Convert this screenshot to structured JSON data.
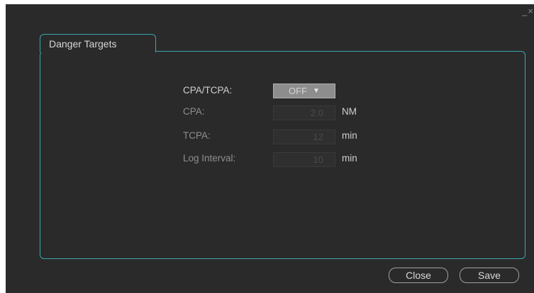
{
  "window": {
    "minimize_glyph": "_",
    "close_glyph": "×"
  },
  "tab": {
    "label": "Danger Targets"
  },
  "form": {
    "cpa_tcpa": {
      "label": "CPA/TCPA:",
      "value": "OFF"
    },
    "cpa": {
      "label": "CPA:",
      "value": "2.0",
      "unit": "NM"
    },
    "tcpa": {
      "label": "TCPA:",
      "value": "12",
      "unit": "min"
    },
    "log_interval": {
      "label": "Log Interval:",
      "value": "10",
      "unit": "min"
    }
  },
  "buttons": {
    "close": "Close",
    "save": "Save"
  },
  "colors": {
    "accent": "#3aa6b0",
    "background": "#2a2a2a"
  },
  "icons": {
    "dropdown": "triangle-down-icon"
  }
}
